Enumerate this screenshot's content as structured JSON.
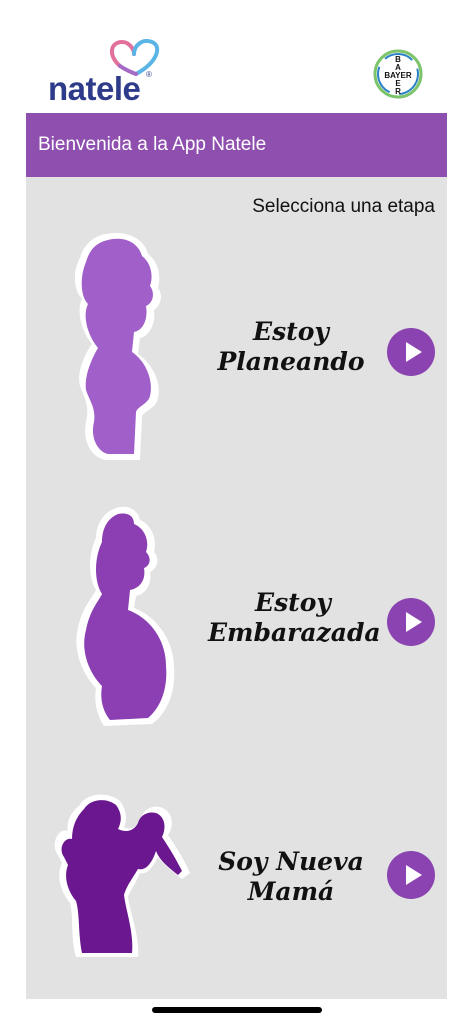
{
  "header": {
    "logo_text": "natele",
    "logo_registered": "®",
    "partner_logo_text": "BAYER"
  },
  "banner": {
    "title": "Bienvenida a la App Natele"
  },
  "content": {
    "subtitle": "Selecciona una etapa",
    "stages": [
      {
        "line1": "Estoy",
        "line2": "Planeando",
        "icon": "woman-silhouette-icon"
      },
      {
        "line1": "Estoy",
        "line2": "Embarazada",
        "icon": "pregnant-woman-silhouette-icon"
      },
      {
        "line1": "Soy Nueva",
        "line2": "Mamá",
        "icon": "mother-baby-silhouette-icon"
      }
    ]
  },
  "colors": {
    "brand_purple": "#8e4fae",
    "play_button": "#8a43b0",
    "panel_bg": "#e2e2e2",
    "logo_blue": "#2e3a8a"
  }
}
